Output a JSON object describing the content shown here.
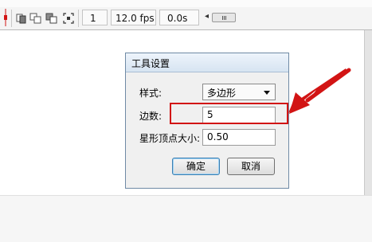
{
  "toolbar": {
    "frame_number": "1",
    "frame_rate": "12.0 fps",
    "elapsed_time": "0.0s",
    "icons": [
      "playhead-icon",
      "center-frame-icon",
      "onion-skin-icon",
      "onion-skin-outlines-icon",
      "edit-multiple-frames-icon",
      "modify-onion-markers-icon"
    ]
  },
  "dialog": {
    "title": "工具设置",
    "style_label": "样式:",
    "style_value": "多边形",
    "sides_label": "边数:",
    "sides_value": "5",
    "star_point_label": "星形顶点大小:",
    "star_point_value": "0.50",
    "ok_label": "确定",
    "cancel_label": "取消"
  },
  "colors": {
    "annotation": "#d21414",
    "title_bar": "#dce7f3",
    "dialog_bg": "#f0f0f0"
  }
}
